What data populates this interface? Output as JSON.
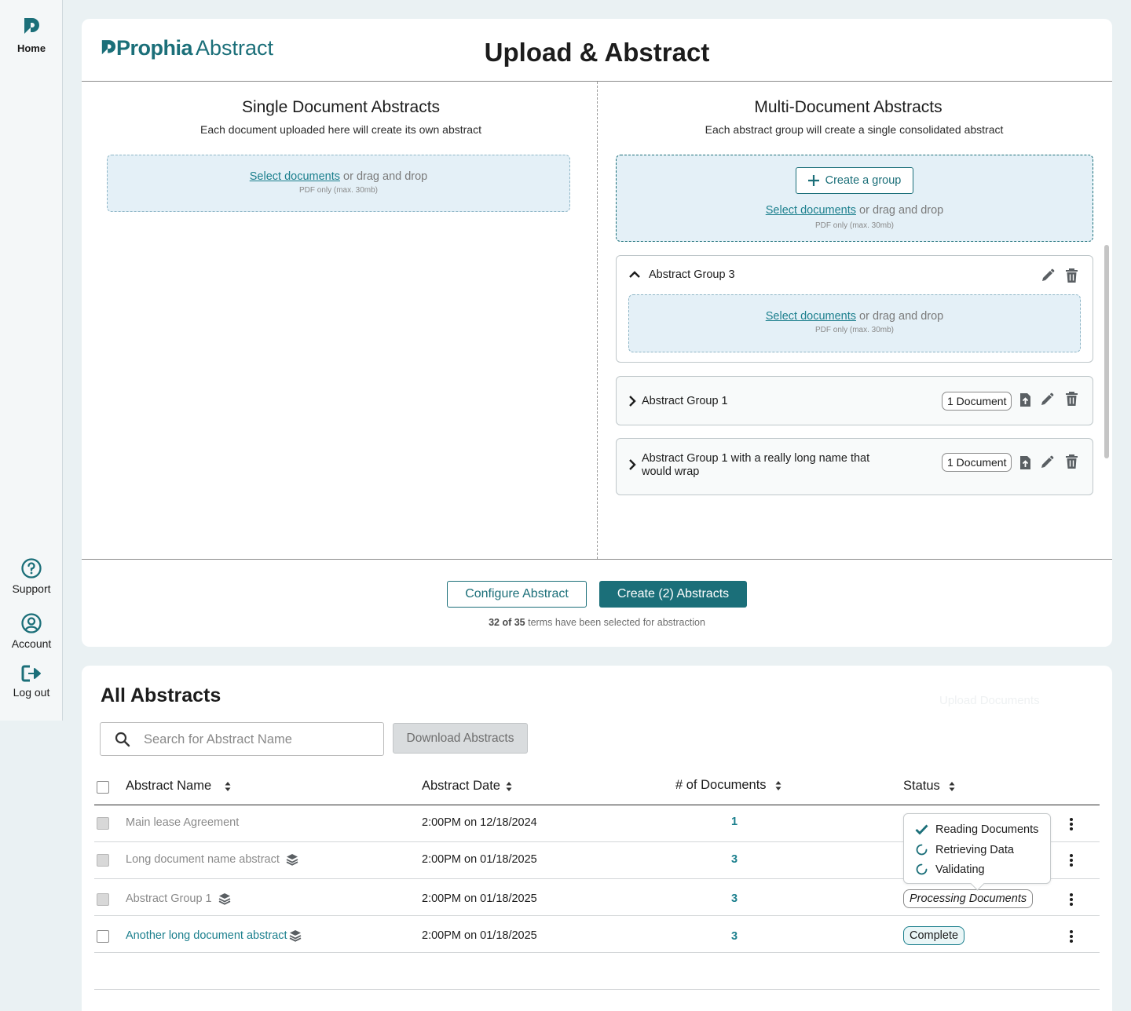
{
  "sidebar": {
    "home": "Home",
    "support": "Support",
    "account": "Account",
    "logout": "Log out"
  },
  "brand": {
    "bold": "Prophia",
    "light": "Abstract"
  },
  "page_title": "Upload & Abstract",
  "single": {
    "title": "Single Document Abstracts",
    "subtitle": "Each document uploaded here will create its own abstract",
    "select_link": "Select documents",
    "drag_text": " or drag and drop",
    "note": "PDF only (max. 30mb)"
  },
  "multi": {
    "title": "Multi-Document Abstracts",
    "subtitle": "Each abstract group will create a single consolidated abstract",
    "create_group": "Create a group",
    "select_link": "Select documents",
    "drag_text": " or drag and drop",
    "note": "PDF only (max. 30mb)",
    "groups": [
      {
        "name": "Abstract Group 3",
        "expanded": true,
        "select_link": "Select documents",
        "drag_text": " or drag and drop",
        "note": "PDF only (max. 30mb)"
      },
      {
        "name": "Abstract Group 1",
        "expanded": false,
        "badge": "1 Document"
      },
      {
        "name": "Abstract Group 1 with a really long name that would wrap",
        "expanded": false,
        "badge": "1 Document"
      }
    ]
  },
  "actions": {
    "configure": "Configure Abstract",
    "create": "Create (2) Abstracts",
    "terms_selected": "32 of 35",
    "terms_rest": " terms have been selected for abstraction"
  },
  "list": {
    "title": "All Abstracts",
    "ghost_label": "Upload Documents",
    "search_placeholder": "Search for Abstract Name",
    "download": "Download Abstracts",
    "columns": [
      "Abstract Name",
      "Abstract Date",
      "# of Documents",
      "Status"
    ],
    "rows": [
      {
        "name": "Main lease Agreement",
        "date": "2:00PM on 12/18/2024",
        "docs": "1",
        "status": ""
      },
      {
        "name": "Long document name abstract",
        "date": "2:00PM on 01/18/2025",
        "docs": "3",
        "status": ""
      },
      {
        "name": "Abstract Group 1",
        "date": "2:00PM on 01/18/2025",
        "docs": "3",
        "status": "Processing Documents"
      },
      {
        "name": "Another long document abstract",
        "date": "2:00PM on 01/18/2025",
        "docs": "3",
        "status": "Complete"
      }
    ],
    "progress": [
      {
        "label": "Reading Documents",
        "state": "done"
      },
      {
        "label": "Retrieving Data",
        "state": "pending"
      },
      {
        "label": "Validating",
        "state": "pending"
      }
    ]
  },
  "colors": {
    "brand": "#1b6f79",
    "link": "#1b7f8d",
    "dropzone": "#e4f0f7",
    "page_bg": "#eaf1f3"
  }
}
